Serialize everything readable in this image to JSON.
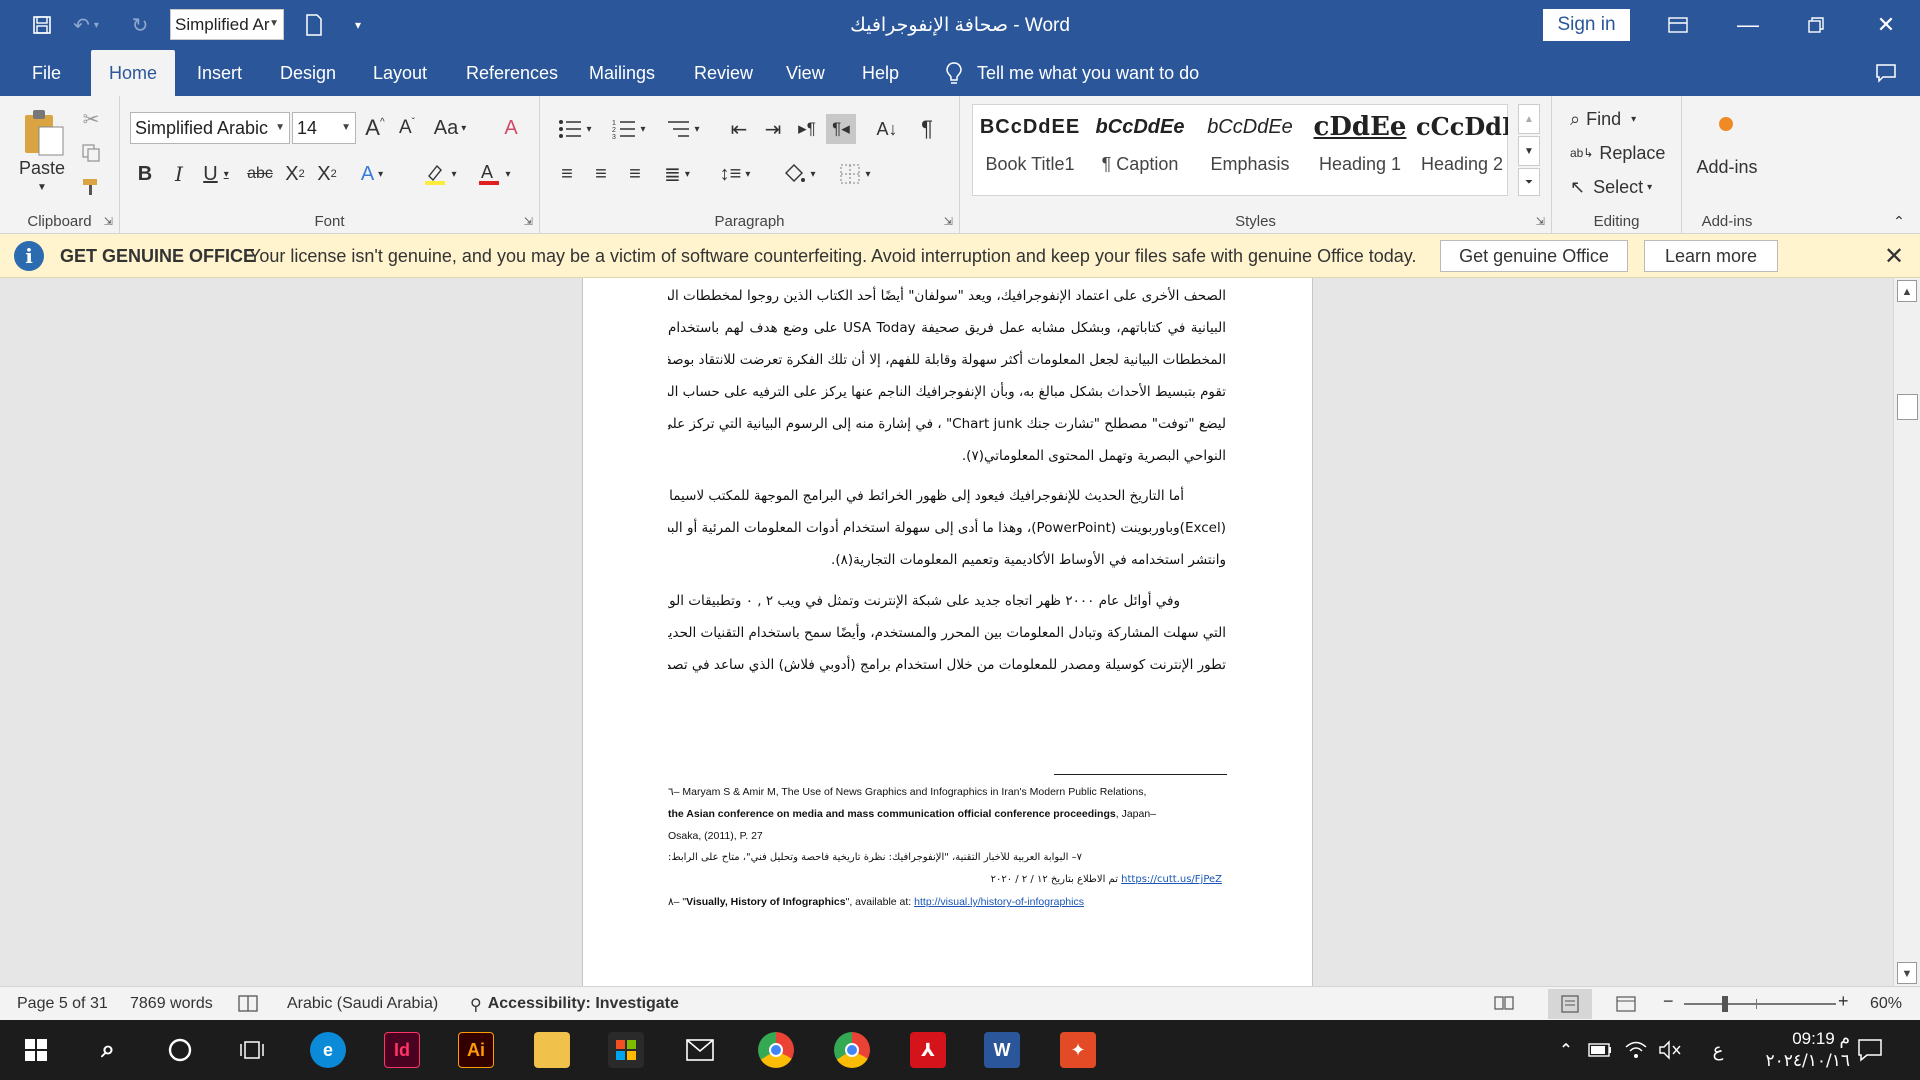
{
  "titlebar": {
    "font_quick": "Simplified Ar",
    "doc_title": "صحافة الإنفوجرافيك  -  Word",
    "sign_in": "Sign in"
  },
  "tabs": [
    "File",
    "Home",
    "Insert",
    "Design",
    "Layout",
    "References",
    "Mailings",
    "Review",
    "View",
    "Help"
  ],
  "tell_me": "Tell me what you want to do",
  "ribbon": {
    "clipboard": {
      "paste": "Paste",
      "label": "Clipboard"
    },
    "font": {
      "name": "Simplified Arabic",
      "size": "14",
      "label": "Font"
    },
    "paragraph": {
      "label": "Paragraph"
    },
    "styles": {
      "label": "Styles",
      "items": [
        {
          "preview": "BCcDdEE",
          "name": "Book Title1"
        },
        {
          "preview": "bCcDdEe",
          "name": "¶ Caption"
        },
        {
          "preview": "bCcDdEe",
          "name": "Emphasis"
        },
        {
          "preview": "cDdEe",
          "name": "Heading 1"
        },
        {
          "preview": "cCcDdEe",
          "name": "Heading 2"
        }
      ]
    },
    "editing": {
      "find": "Find",
      "replace": "Replace",
      "select": "Select",
      "label": "Editing"
    },
    "addins": {
      "button": "Add-ins",
      "label": "Add-ins"
    }
  },
  "message_bar": {
    "heading": "GET GENUINE OFFICE",
    "text": "Your license isn't genuine, and you may be a victim of software counterfeiting. Avoid interruption and keep your files safe with genuine Office today.",
    "primary": "Get genuine Office",
    "secondary": "Learn more"
  },
  "document": {
    "para1": [
      "الصحف الأخرى على اعتماد الإنفوجرافيك، ويعد \"سولفان\" أيضًا أحد الكتاب الذين روجوا لمخططات المعلومات",
      "البيانية في كتاباتهم، وبشكل مشابه عمل فريق صحيفة USA Today على وضع هدف لهم باستخدام",
      "المخططات البيانية لجعل المعلومات أكثر سهولة وقابلة للفهم، إلا أن تلك الفكرة تعرضت للانتقاد بوصفها",
      "تقوم بتبسيط الأحداث بشكل مبالغ به، وبأن الإنفوجرافيك الناجم عنها يركز على الترفيه على حساب المحتوى،",
      "ليضع \"توفت\" مصطلح \"تشارت جنك Chart junk\" ، في إشارة منه إلى الرسوم البيانية التي تركز على",
      "النواحي البصرية وتهمل المحتوى المعلوماتي(٧)."
    ],
    "para2": [
      "أما التاريخ الحديث للإنفوجرافيك فيعود إلى ظهور الخرائط في البرامج الموجهة للمكتب لاسيما إكسيل",
      "(Excel)وباوربوينت (PowerPoint)، وهذا ما أدى إلى سهولة استخدام أدوات المعلومات المرئية أو البصرية،",
      "وانتشر استخدامه في الأوساط الأكاديمية وتعميم المعلومات التجارية(٨)."
    ],
    "para3": [
      "وفي أوائل عام ٢٠٠٠ ظهر اتجاه جديد على شبكة الإنترنت وتمثل في ويب ٢ , ٠ وتطبيقات الويب",
      "التي سهلت المشاركة وتبادل المعلومات بين المحرر والمستخدم، وأيضًا سمح باستخدام التقنيات الحديثة في",
      "تطور الإنترنت كوسيلة ومصدر للمعلومات من خلال استخدام برامج (أدوبي فلاش) الذي ساعد في تصميم"
    ],
    "footnote1_a": "٦– Maryam S & Amir M, The Use of News Graphics and Infographics in Iran's Modern Public Relations,",
    "footnote1_b_bold": "the Asian conference on media and mass communication official conference proceedings",
    "footnote1_b_rest": ", Japan–",
    "footnote1_c": "Osaka, (2011), P. 27",
    "footnote2_a": "٧– البوابة العربية للأخبار التقنية، \"الإنفوجرافيك: نظرة تاريخية فاحصة وتحليل فني\"، متاح على الرابط:",
    "footnote2_link": "https://cutt.us/FjPeZ",
    "footnote2_date": "تم الاطلاع بتاريخ ١٢ / ٢ / ٢٠٢٠",
    "footnote3_pre": "٨– \"",
    "footnote3_bold": "Visually, History of Infographics",
    "footnote3_mid": "\", available at: ",
    "footnote3_link": "http://visual.ly/history-of-infographics"
  },
  "statusbar": {
    "page": "Page 5 of 31",
    "words": "7869 words",
    "language": "Arabic (Saudi Arabia)",
    "accessibility": "Accessibility: Investigate",
    "zoom": "60%"
  },
  "taskbar": {
    "time": "09:19 م",
    "date": "٢٠٢٤/١٠/١٦",
    "ime": "ع"
  },
  "colors": {
    "titlebar": "#2b579a",
    "ribbon": "#f3f3f3",
    "message_bar": "#fff4ce",
    "page": "#ffffff"
  }
}
